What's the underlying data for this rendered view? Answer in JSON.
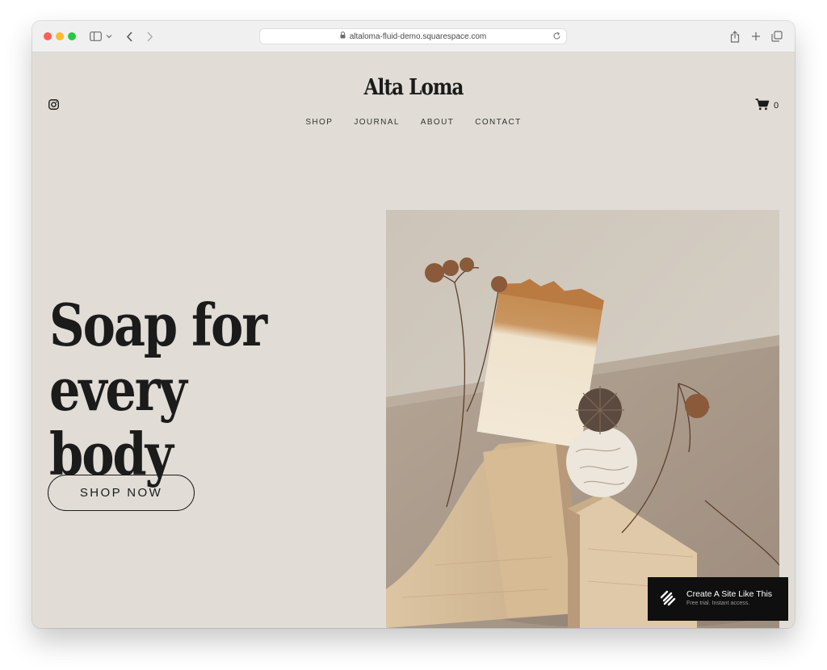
{
  "browser": {
    "url": "altaloma-fluid-demo.squarespace.com"
  },
  "site": {
    "logo": "Alta Loma",
    "nav": [
      "SHOP",
      "JOURNAL",
      "ABOUT",
      "CONTACT"
    ],
    "cart_count": "0",
    "headline_line1": "Soap for",
    "headline_line2": "every body",
    "cta_label": "SHOP NOW"
  },
  "badge": {
    "title": "Create A Site Like This",
    "subtitle": "Free trial. Instant access."
  },
  "icons": [
    "instagram-icon",
    "cart-icon",
    "sidebar-icon",
    "chevron-down-icon",
    "back-icon",
    "forward-icon",
    "lock-icon",
    "reload-icon",
    "share-icon",
    "plus-icon",
    "tabs-icon",
    "squarespace-logo-icon"
  ],
  "colors": {
    "page_bg": "#e1ddd6",
    "text": "#1b1b1b",
    "badge_bg": "#0f0f0f"
  }
}
